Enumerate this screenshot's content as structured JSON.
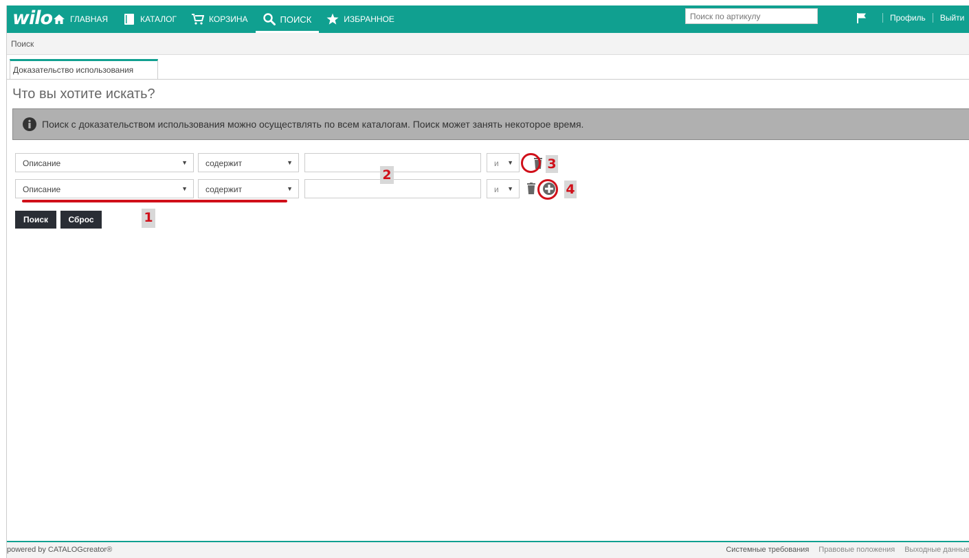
{
  "header": {
    "logo": "wilo",
    "nav": [
      {
        "label": "ГЛАВНАЯ",
        "icon": "home-icon"
      },
      {
        "label": "КАТАЛОГ",
        "icon": "book-icon"
      },
      {
        "label": "КОРЗИНА",
        "icon": "cart-icon"
      },
      {
        "label": "ПОИСК",
        "icon": "search-icon",
        "active": true
      },
      {
        "label": "ИЗБРАННОЕ",
        "icon": "star-icon"
      }
    ],
    "search_placeholder": "Поиск по артикулу",
    "profile_label": "Профиль",
    "logout_label": "Выйти",
    "accent_color": "#10a090"
  },
  "breadcrumb": "Поиск",
  "tab_label": "Доказательство использования",
  "page_title": "Что вы хотите искать?",
  "info_message": "Поиск с доказательством использования можно осуществлять по всем каталогам. Поиск может занять некоторое время.",
  "rows": [
    {
      "field": "Описание",
      "operator": "содержит",
      "value": "",
      "logic": "и"
    },
    {
      "field": "Описание",
      "operator": "содержит",
      "value": "",
      "logic": "и"
    }
  ],
  "markers": [
    "1",
    "2",
    "3",
    "4"
  ],
  "buttons": {
    "search": "Поиск",
    "reset": "Сброс"
  },
  "footer": {
    "powered_by": "powered by CATALOGcreator®",
    "links": [
      "Системные требования",
      "Правовые положения",
      "Выходные данные"
    ]
  },
  "annotation_color": "#d0101a"
}
